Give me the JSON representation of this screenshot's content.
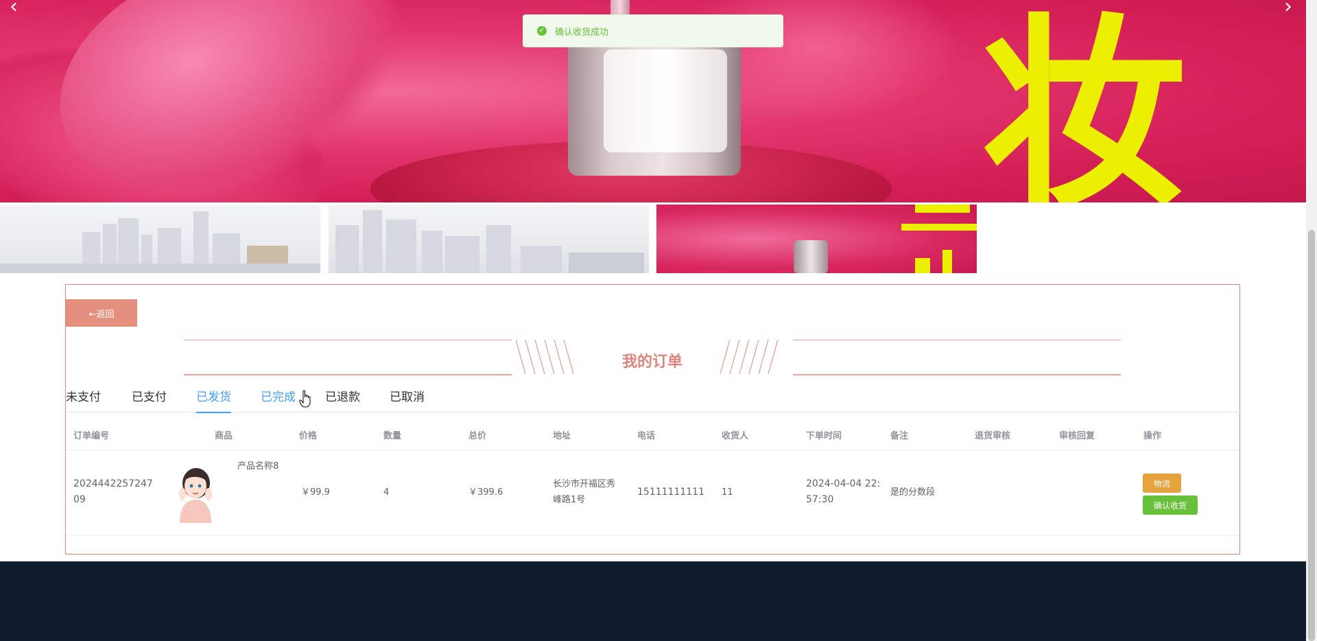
{
  "toast": {
    "message": "确认收货成功"
  },
  "banner": {
    "hero_text": "妆",
    "thumb_text": "妆"
  },
  "panel": {
    "back_label": "←返回",
    "title": "我的订单",
    "tabs": [
      {
        "label": "未支付"
      },
      {
        "label": "已支付"
      },
      {
        "label": "已发货"
      },
      {
        "label": "已完成"
      },
      {
        "label": "已退款"
      },
      {
        "label": "已取消"
      }
    ],
    "active_tab": "已发货"
  },
  "table": {
    "columns": [
      "订单编号",
      "商品",
      "价格",
      "数量",
      "总价",
      "地址",
      "电话",
      "收货人",
      "下单时间",
      "备注",
      "退货审核",
      "审核回复",
      "操作"
    ],
    "rows": [
      {
        "order_no": "2024442257247\n09",
        "product_name": "产品名称8",
        "price": "￥99.9",
        "quantity": "4",
        "total": "￥399.6",
        "address": "长沙市开福区秀\n峰路1号",
        "phone": "15111111111",
        "receiver": "11",
        "order_time": "2024-04-04 22:\n57:30",
        "remark": "是的分数段",
        "return_audit": "",
        "audit_reply": "",
        "actions": {
          "logistics": "物流",
          "confirm": "确认收货"
        }
      }
    ]
  },
  "colors": {
    "accent": "#e0837a",
    "tab_active": "#409eff",
    "success": "#67c23a",
    "warning": "#e6a23c",
    "footer": "#0f1c2e"
  }
}
